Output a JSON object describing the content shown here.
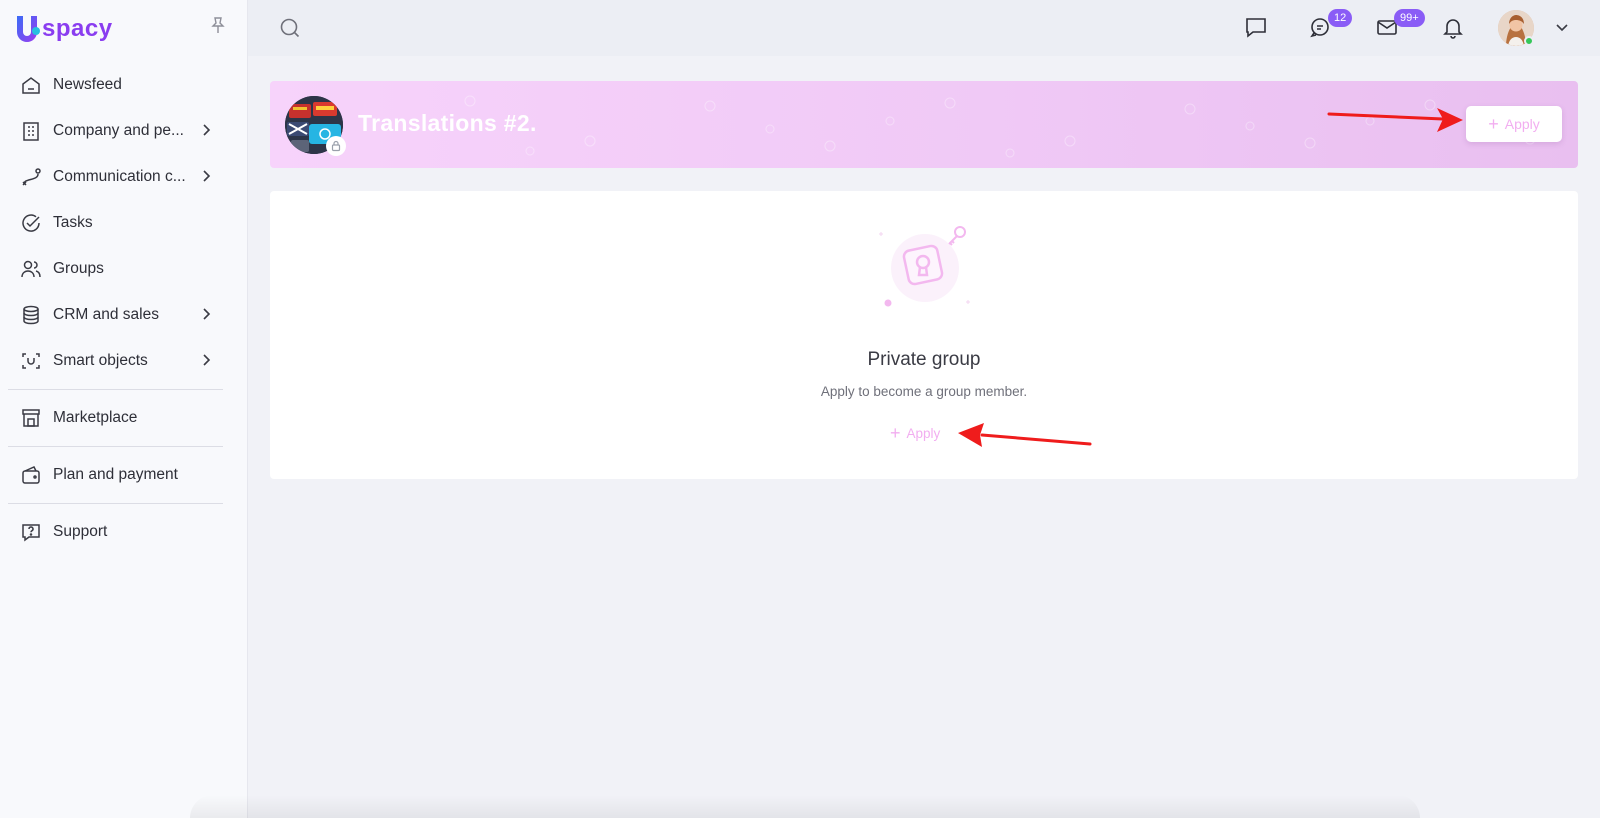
{
  "app": {
    "logo_text": "spacy",
    "brand_color": "#8a3df0"
  },
  "sidebar": {
    "items": [
      {
        "label": "Newsfeed",
        "icon": "home-icon"
      },
      {
        "label": "Company and pe...",
        "icon": "building-icon",
        "has_submenu": true
      },
      {
        "label": "Communication c...",
        "icon": "route-icon",
        "has_submenu": true
      },
      {
        "label": "Tasks",
        "icon": "check-circle-icon"
      },
      {
        "label": "Groups",
        "icon": "users-icon"
      },
      {
        "label": "CRM and sales",
        "icon": "database-icon",
        "has_submenu": true
      },
      {
        "label": "Smart objects",
        "icon": "scan-icon",
        "has_submenu": true
      },
      {
        "label": "Marketplace",
        "icon": "store-icon"
      },
      {
        "label": "Plan and payment",
        "icon": "wallet-icon"
      },
      {
        "label": "Support",
        "icon": "help-icon"
      }
    ]
  },
  "topbar": {
    "chat_badge": "12",
    "mail_badge": "99+",
    "badge_color": "#8a5cf6"
  },
  "group": {
    "title": "Translations #2.",
    "apply_label": "Apply"
  },
  "private_card": {
    "title": "Private group",
    "subtitle": "Apply to become a group member.",
    "apply_label": "Apply"
  },
  "colors": {
    "accent_pink": "#f2aef0",
    "annotation_red": "#ef1c1c"
  }
}
